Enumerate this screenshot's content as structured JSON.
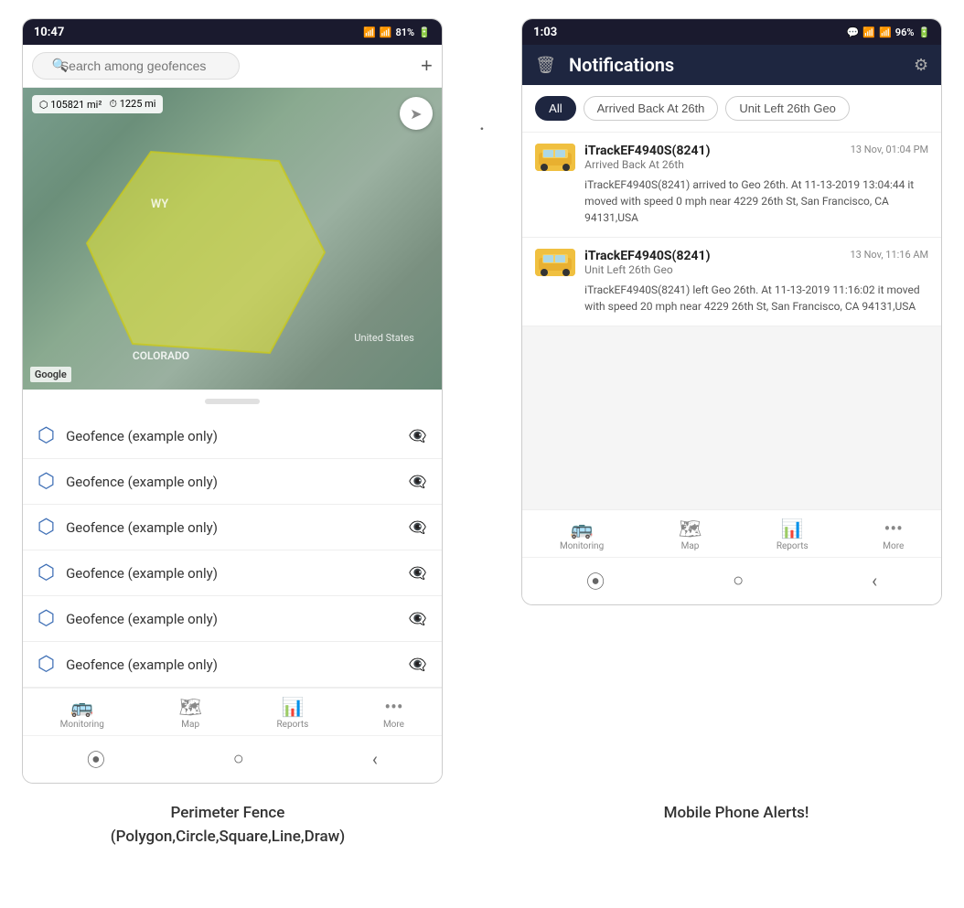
{
  "left_phone": {
    "status_bar": {
      "time": "10:47",
      "wifi": "WiFi",
      "signal": "Signal",
      "battery": "81%"
    },
    "search": {
      "placeholder": "Search among geofences"
    },
    "map": {
      "area_label": "105821 mi²",
      "distance_label": "1225 mi",
      "region_wy": "WY",
      "region_us": "United States",
      "region_colorado": "COLORADO",
      "google_label": "Google"
    },
    "geofences": [
      {
        "name": "Geofence (example only)"
      },
      {
        "name": "Geofence (example only)"
      },
      {
        "name": "Geofence (example only)"
      },
      {
        "name": "Geofence (example only)"
      },
      {
        "name": "Geofence (example only)"
      },
      {
        "name": "Geofence (example only)"
      }
    ],
    "bottom_nav": [
      {
        "label": "Monitoring",
        "icon": "🚌"
      },
      {
        "label": "Map",
        "icon": "🗺"
      },
      {
        "label": "Reports",
        "icon": "📊"
      },
      {
        "label": "More",
        "icon": "···"
      }
    ],
    "caption": "Perimeter Fence\n(Polygon,Circle,Square,Line,Draw)"
  },
  "right_phone": {
    "status_bar": {
      "time": "1:03",
      "battery": "96%"
    },
    "header": {
      "title": "Notifications",
      "delete_icon": "🗑",
      "settings_icon": "⚙"
    },
    "filters": [
      {
        "label": "All",
        "active": true
      },
      {
        "label": "Arrived Back At 26th",
        "active": false
      },
      {
        "label": "Unit Left 26th Geo",
        "active": false
      }
    ],
    "notifications": [
      {
        "device": "iTrackEF4940S(8241)",
        "timestamp": "13 Nov, 01:04 PM",
        "event_type": "Arrived Back At 26th",
        "body": "iTrackEF4940S(8241) arrived to Geo 26th.    At 11-13-2019 13:04:44 it moved with speed 0 mph near 4229 26th St, San Francisco, CA 94131,USA"
      },
      {
        "device": "iTrackEF4940S(8241)",
        "timestamp": "13 Nov, 11:16 AM",
        "event_type": "Unit Left 26th Geo",
        "body": "iTrackEF4940S(8241) left Geo 26th.   At 11-13-2019 11:16:02 it moved with speed 20 mph near 4229 26th St, San Francisco, CA 94131,USA"
      }
    ],
    "bottom_nav": [
      {
        "label": "Monitoring",
        "icon": "🚌"
      },
      {
        "label": "Map",
        "icon": "🗺"
      },
      {
        "label": "Reports",
        "icon": "📊"
      },
      {
        "label": "More",
        "icon": "···"
      }
    ],
    "caption": "Mobile Phone Alerts!"
  },
  "separator": "."
}
